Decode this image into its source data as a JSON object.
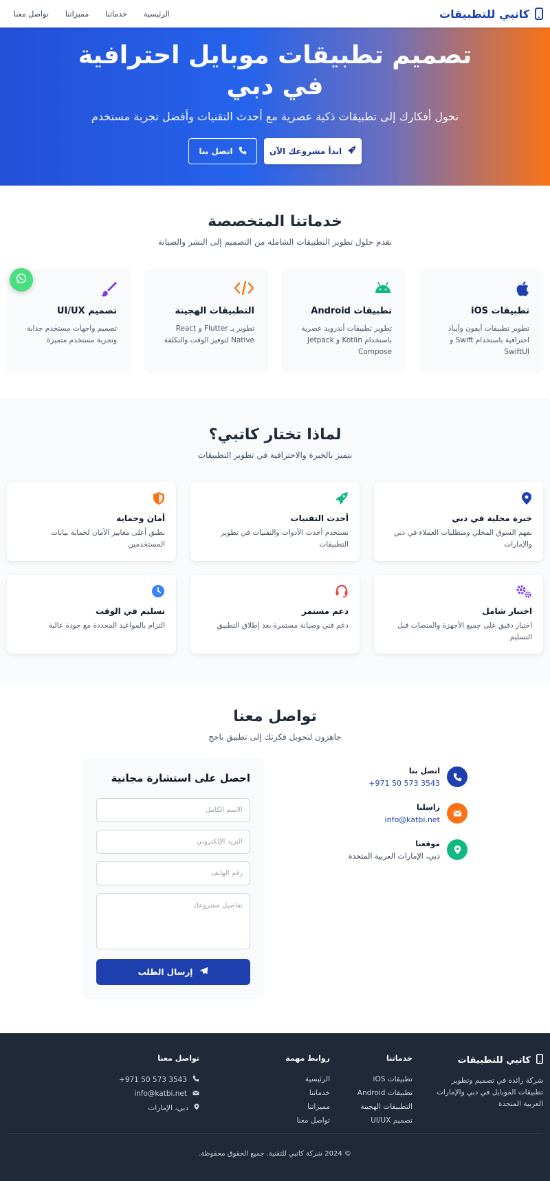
{
  "navbar": {
    "brand": "كاتبي للتطبيقات",
    "links": [
      "الرئيسية",
      "خدماتنا",
      "مميزاتنا",
      "تواصل معنا"
    ]
  },
  "hero": {
    "title": "تصميم تطبيقات موبايل احترافية في دبي",
    "subtitle": "نحول أفكارك إلى تطبيقات ذكية عصرية مع أحدث التقنيات وأفضل تجربة مستخدم",
    "primary_btn": "ابدأ مشروعك الآن",
    "secondary_btn": "اتصل بنا"
  },
  "services": {
    "title": "خدماتنا المتخصصة",
    "subtitle": "نقدم حلول تطوير التطبيقات الشاملة من التصميم إلى النشر والصيانة",
    "items": [
      {
        "title": "تطبيقات iOS",
        "desc": "تطوير تطبيقات آيفون وآيباد احترافية باستخدام Swift و SwiftUI",
        "icon": "apple-icon"
      },
      {
        "title": "تطبيقات Android",
        "desc": "تطوير تطبيقات أندرويد عصرية باستخدام Kotlin و Jetpack Compose",
        "icon": "android-icon"
      },
      {
        "title": "التطبيقات الهجينة",
        "desc": "تطوير بـ Flutter و React Native لتوفير الوقت والتكلفة",
        "icon": "code-icon"
      },
      {
        "title": "تصميم UI/UX",
        "desc": "تصميم واجهات مستخدم جذابة وتجربة مستخدم متميزة",
        "icon": "paintbrush-icon"
      }
    ]
  },
  "why": {
    "title": "لماذا تختار كاتبي؟",
    "subtitle": "نتميز بالخبرة والاحترافية في تطوير التطبيقات",
    "items": [
      {
        "title": "خبرة محلية في دبي",
        "desc": "نفهم السوق المحلي ومتطلبات العملاء في دبي والإمارات",
        "icon": "map-pin-icon"
      },
      {
        "title": "أحدث التقنيات",
        "desc": "نستخدم أحدث الأدوات والتقنيات في تطوير التطبيقات",
        "icon": "rocket-icon"
      },
      {
        "title": "أمان وحماية",
        "desc": "نطبق أعلى معايير الأمان لحماية بيانات المستخدمين",
        "icon": "shield-icon"
      },
      {
        "title": "اختبار شامل",
        "desc": "اختبار دقيق على جميع الأجهزة والمنصات قبل التسليم",
        "icon": "gears-icon"
      },
      {
        "title": "دعم مستمر",
        "desc": "دعم فني وصيانة مستمرة بعد إطلاق التطبيق",
        "icon": "headset-icon"
      },
      {
        "title": "تسليم في الوقت",
        "desc": "التزام بالمواعيد المحددة مع جودة عالية",
        "icon": "clock-icon"
      }
    ]
  },
  "contact": {
    "title": "تواصل معنا",
    "subtitle": "جاهزون لتحويل فكرتك إلى تطبيق ناجح",
    "info": [
      {
        "label": "اتصل بنا",
        "value": "+971 50 573 3543"
      },
      {
        "label": "راسلنا",
        "value": "info@katbi.net"
      },
      {
        "label": "موقعنا",
        "value": "دبي، الإمارات العربية المتحدة"
      }
    ],
    "form": {
      "title": "احصل على استشارة مجانية",
      "name_placeholder": "الاسم الكامل",
      "email_placeholder": "البريد الإلكتروني",
      "phone_placeholder": "رقم الهاتف",
      "details_placeholder": "تفاصيل مشروعك",
      "submit": "إرسال الطلب"
    }
  },
  "footer": {
    "brand": "كاتبي للتطبيقات",
    "description": "شركة رائدة في تصميم وتطوير تطبيقات الموبايل في دبي والإمارات العربية المتحدة",
    "services_title": "خدماتنا",
    "services": [
      "تطبيقات iOS",
      "تطبيقات Android",
      "التطبيقات الهجينة",
      "تصميم UI/UX"
    ],
    "links_title": "روابط مهمة",
    "links": [
      "الرئيسية",
      "خدماتنا",
      "مميزاتنا",
      "تواصل معنا"
    ],
    "contact_title": "تواصل معنا",
    "contact": [
      "+971 50 573 3543",
      "info@katbi.net",
      "دبي، الإمارات"
    ],
    "copyright": "© 2024 شركة كاتبي للتقنية. جميع الحقوق محفوظة."
  },
  "colors": {
    "brand_blue": "#1e40af",
    "orange": "#f97316",
    "green": "#10b981",
    "purple": "#7c3aed",
    "red": "#ef4444",
    "whatsapp": "#4ade80",
    "footer_bg": "#1f2937"
  }
}
